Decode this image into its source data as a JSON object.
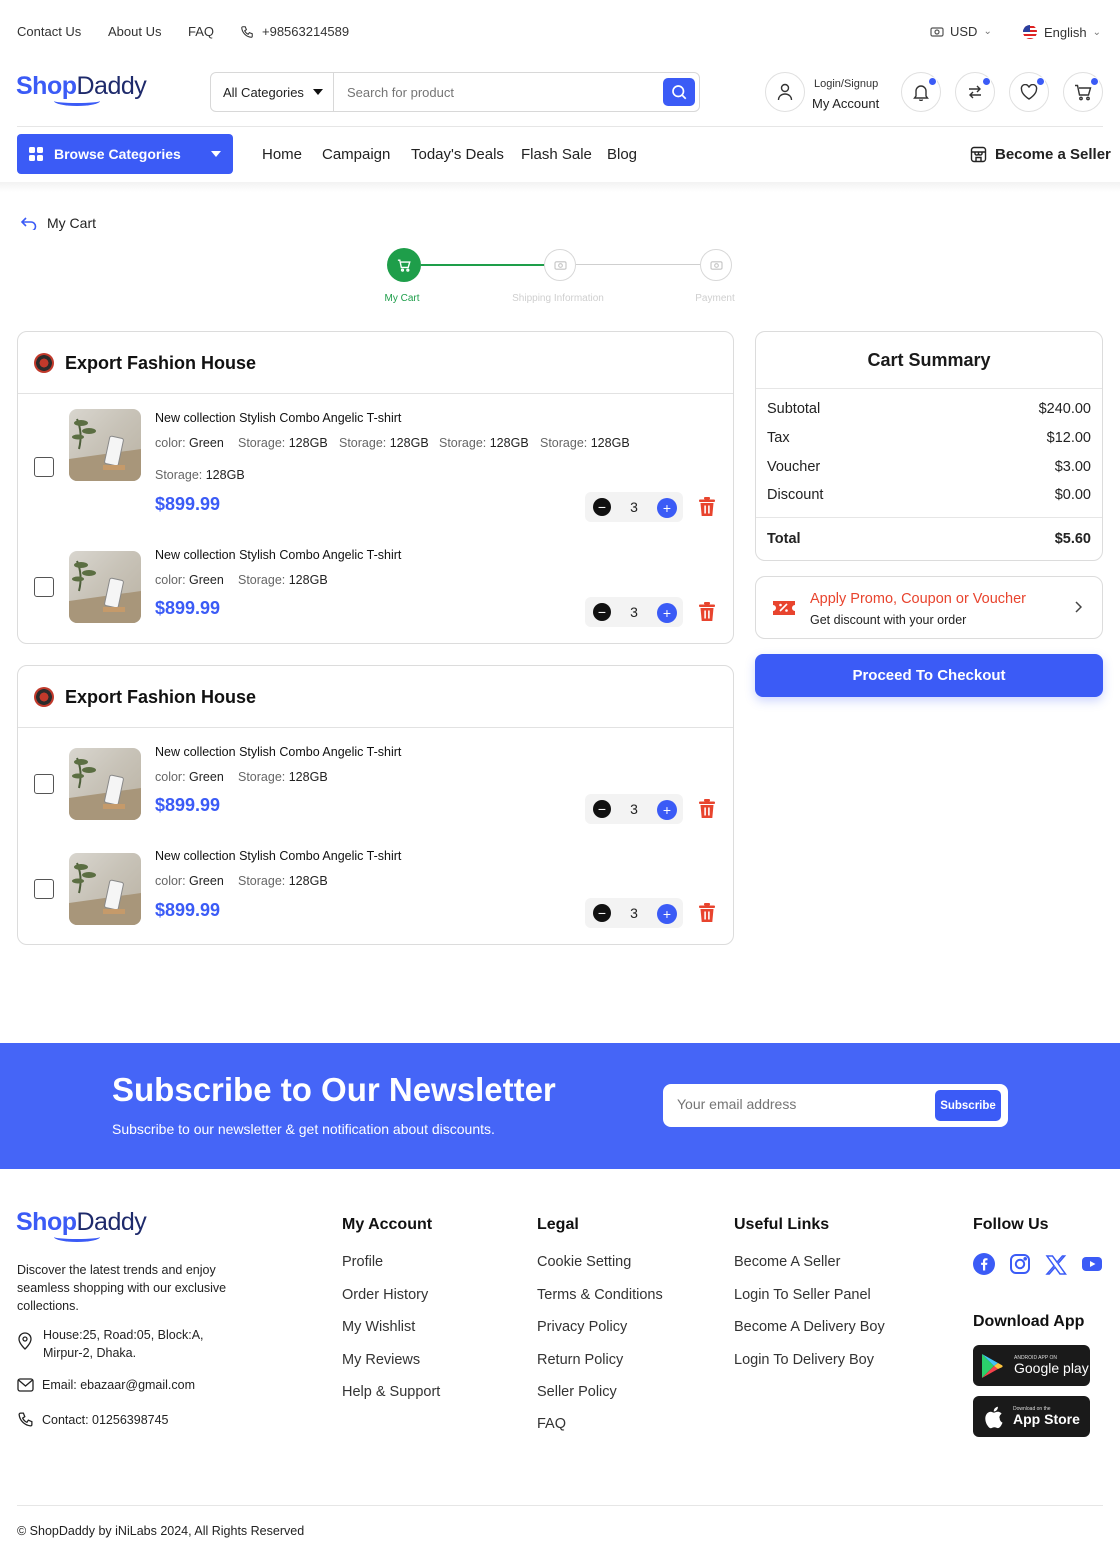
{
  "topbar": {
    "contact": "Contact Us",
    "about": "About Us",
    "faq": "FAQ",
    "phone": "+98563214589",
    "currency": "USD",
    "language": "English"
  },
  "brand": {
    "part1": "Shop",
    "part2": "Daddy"
  },
  "search": {
    "category": "All Categories",
    "placeholder": "Search for product"
  },
  "account": {
    "top": "Login/Signup",
    "bottom": "My Account"
  },
  "nav": {
    "browse": "Browse Categories",
    "links": [
      "Home",
      "Campaign",
      "Today's Deals",
      "Flash Sale",
      "Blog"
    ],
    "seller": "Become a Seller"
  },
  "breadcrumb": "My Cart",
  "steps": [
    {
      "label": "My Cart",
      "active": true
    },
    {
      "label": "Shipping Information",
      "active": false
    },
    {
      "label": "Payment",
      "active": false
    }
  ],
  "shops": [
    {
      "name": "Export Fashion House",
      "items": [
        {
          "title": "New collection Stylish Combo Angelic T-shirt",
          "attrs": [
            {
              "k": "color",
              "v": "Green"
            },
            {
              "k": "Storage",
              "v": "128GB"
            },
            {
              "k": "Storage",
              "v": "128GB"
            },
            {
              "k": "Storage",
              "v": "128GB"
            },
            {
              "k": "Storage",
              "v": "128GB"
            },
            {
              "k": "Storage",
              "v": "128GB"
            }
          ],
          "price": "$899.99",
          "qty": "3"
        },
        {
          "title": "New collection Stylish Combo Angelic T-shirt",
          "attrs": [
            {
              "k": "color",
              "v": "Green"
            },
            {
              "k": "Storage",
              "v": "128GB"
            }
          ],
          "price": "$899.99",
          "qty": "3"
        }
      ]
    },
    {
      "name": "Export Fashion House",
      "items": [
        {
          "title": "New collection Stylish Combo Angelic T-shirt",
          "attrs": [
            {
              "k": "color",
              "v": "Green"
            },
            {
              "k": "Storage",
              "v": "128GB"
            }
          ],
          "price": "$899.99",
          "qty": "3"
        },
        {
          "title": "New collection Stylish Combo Angelic T-shirt",
          "attrs": [
            {
              "k": "color",
              "v": "Green"
            },
            {
              "k": "Storage",
              "v": "128GB"
            }
          ],
          "price": "$899.99",
          "qty": "3"
        }
      ]
    }
  ],
  "summary": {
    "title": "Cart Summary",
    "rows": [
      {
        "label": "Subtotal",
        "value": "$240.00"
      },
      {
        "label": "Tax",
        "value": "$12.00"
      },
      {
        "label": "Voucher",
        "value": "$3.00"
      },
      {
        "label": "Discount",
        "value": "$0.00"
      }
    ],
    "total_label": "Total",
    "total_value": "$5.60"
  },
  "promo": {
    "title": "Apply Promo, Coupon or Voucher",
    "subtitle": "Get discount with your order"
  },
  "checkout": "Proceed To Checkout",
  "newsletter": {
    "title": "Subscribe to Our Newsletter",
    "subtitle": "Subscribe to our newsletter & get notification about discounts.",
    "placeholder": "Your email address",
    "button": "Subscribe"
  },
  "footer": {
    "description": "Discover the latest trends and enjoy seamless shopping with our exclusive collections.",
    "address": "House:25, Road:05, Block:A, Mirpur-2, Dhaka.",
    "email": "Email: ebazaar@gmail.com",
    "contact": "Contact: 01256398745",
    "columns": [
      {
        "title": "My Account",
        "links": [
          "Profile",
          "Order History",
          "My Wishlist",
          "My Reviews",
          "Help & Support"
        ]
      },
      {
        "title": "Legal",
        "links": [
          "Cookie Setting",
          "Terms & Conditions",
          "Privacy Policy",
          "Return Policy",
          "Seller Policy",
          "FAQ"
        ]
      },
      {
        "title": "Useful Links",
        "links": [
          "Become A Seller",
          "Login To Seller Panel",
          "Become A Delivery Boy",
          "Login To Delivery Boy"
        ]
      }
    ],
    "follow": "Follow Us",
    "download": "Download App",
    "google_small": "ANDROID APP ON",
    "google_big": "Google play",
    "apple_small": "Download on the",
    "apple_big": "App Store",
    "copyright": "© ShopDaddy by iNiLabs 2024, All Rights Reserved"
  },
  "colors": {
    "accent": "#3b5bf6",
    "success": "#1e9e4a",
    "danger": "#e8442e"
  }
}
